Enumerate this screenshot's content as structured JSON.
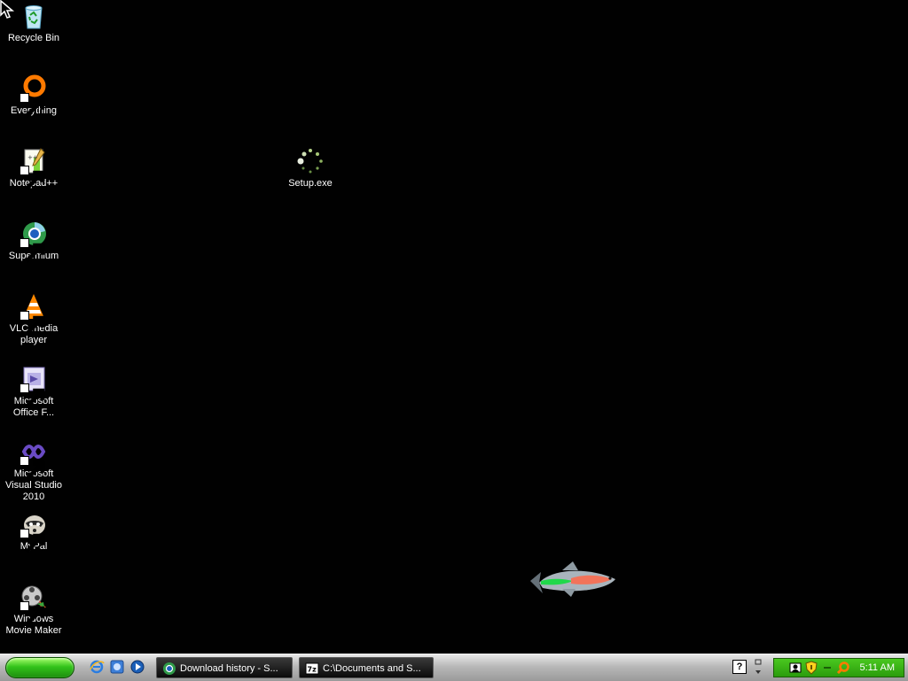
{
  "desktop": {
    "icons": [
      {
        "label": "Recycle Bin",
        "icon": "recycle-bin-icon"
      },
      {
        "label": "Everything",
        "icon": "everything-icon"
      },
      {
        "label": "Notepad++",
        "icon": "notepad-plus-plus-icon"
      },
      {
        "label": "Supermium",
        "icon": "supermium-icon"
      },
      {
        "label": "VLC media player",
        "icon": "vlc-icon"
      },
      {
        "label": "Microsoft Office F...",
        "icon": "office-icon"
      },
      {
        "label": "Microsoft Visual Studio 2010",
        "icon": "visual-studio-icon"
      },
      {
        "label": "MyPal",
        "icon": "mypal-icon"
      },
      {
        "label": "Windows Movie Maker",
        "icon": "movie-maker-icon"
      },
      {
        "label": "Setup.exe",
        "icon": "loading-spinner-icon"
      }
    ]
  },
  "taskbar": {
    "tasks": [
      {
        "label": "Download history - S...",
        "icon": "supermium-icon"
      },
      {
        "label": "C:\\Documents and S...",
        "icon": "7zip-icon"
      }
    ],
    "help_label": "?",
    "tray": {
      "clock": "5:11 AM"
    }
  },
  "colors": {
    "desktop_bg": "#010101",
    "start_green": "#33c31b",
    "tray_green": "#2a9c0d"
  }
}
